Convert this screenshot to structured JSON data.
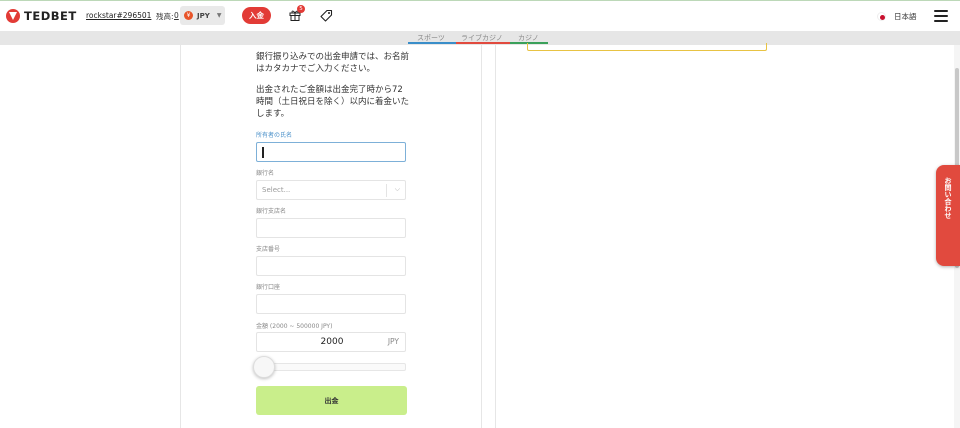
{
  "header": {
    "brand": "TEDBET",
    "username": "rockstar#296501",
    "balance_label": "残高:",
    "balance_value": "0",
    "currency": "JPY",
    "deposit_label": "入金",
    "gift_badge": "5",
    "language": "日本語"
  },
  "tabs": [
    {
      "label": "スポーツ",
      "color": "#3a8ec9"
    },
    {
      "label": "ライブカジノ",
      "color": "#e14a3e"
    },
    {
      "label": "カジノ",
      "color": "#3aa05a"
    }
  ],
  "form": {
    "notice_1": "銀行振り込みでの出金申請では、お名前はカタカナでご入力ください。",
    "notice_2": "出金されたご金額は出金完了時から72時間（土日祝日を除く）以内に着金いたします。",
    "holder_label": "所有者の氏名",
    "holder_value": "",
    "bank_label": "銀行名",
    "bank_placeholder": "Select...",
    "branch_label": "銀行支店名",
    "branch_value": "",
    "branch_number_label": "支店番号",
    "branch_number_value": "",
    "account_label": "銀行口座",
    "account_value": "",
    "amount_label": "金額 (2000 ~ 500000 JPY)",
    "amount_value": "2000",
    "amount_unit": "JPY",
    "slider_level": 0,
    "submit_label": "出金"
  },
  "side_tab": {
    "label": "お問い合わせ"
  },
  "colors": {
    "brand": "#e23b36",
    "submit": "#c9ee8b",
    "focus": "#7db0d8"
  }
}
